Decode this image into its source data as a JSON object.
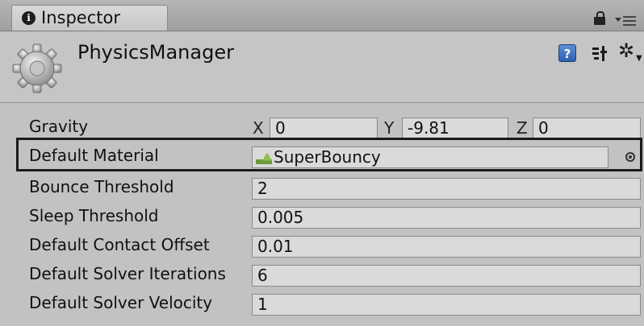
{
  "tab": {
    "label": "Inspector",
    "icon_glyph": "ℹ"
  },
  "header": {
    "object_name": "PhysicsManager",
    "help_glyph": "?"
  },
  "icons": {
    "tab_icon": "info-icon",
    "lock": "lock-icon",
    "menu": "tab-menu-icon",
    "component": "gear-icon",
    "help": "help-icon",
    "preset": "preset-icon",
    "settings": "settings-icon",
    "material": "physic-material-icon",
    "picker": "object-picker-icon"
  },
  "properties": {
    "gravity": {
      "label": "Gravity",
      "x_label": "X",
      "x": "0",
      "y_label": "Y",
      "y": "-9.81",
      "z_label": "Z",
      "z": "0"
    },
    "default_material": {
      "label": "Default Material",
      "value": "SuperBouncy"
    },
    "bounce_threshold": {
      "label": "Bounce Threshold",
      "value": "2"
    },
    "sleep_threshold": {
      "label": "Sleep Threshold",
      "value": "0.005"
    },
    "default_contact_offset": {
      "label": "Default Contact Offset",
      "value": "0.01"
    },
    "default_solver_iterations": {
      "label": "Default Solver Iterations",
      "value": "6"
    },
    "default_solver_velocity": {
      "label": "Default Solver Velocity",
      "value": "1"
    }
  },
  "colors": {
    "panel_bg": "#c2c2c2",
    "field_bg": "#dadada",
    "help_blue": "#2c5fae",
    "highlight_border": "#1a1a1a"
  }
}
